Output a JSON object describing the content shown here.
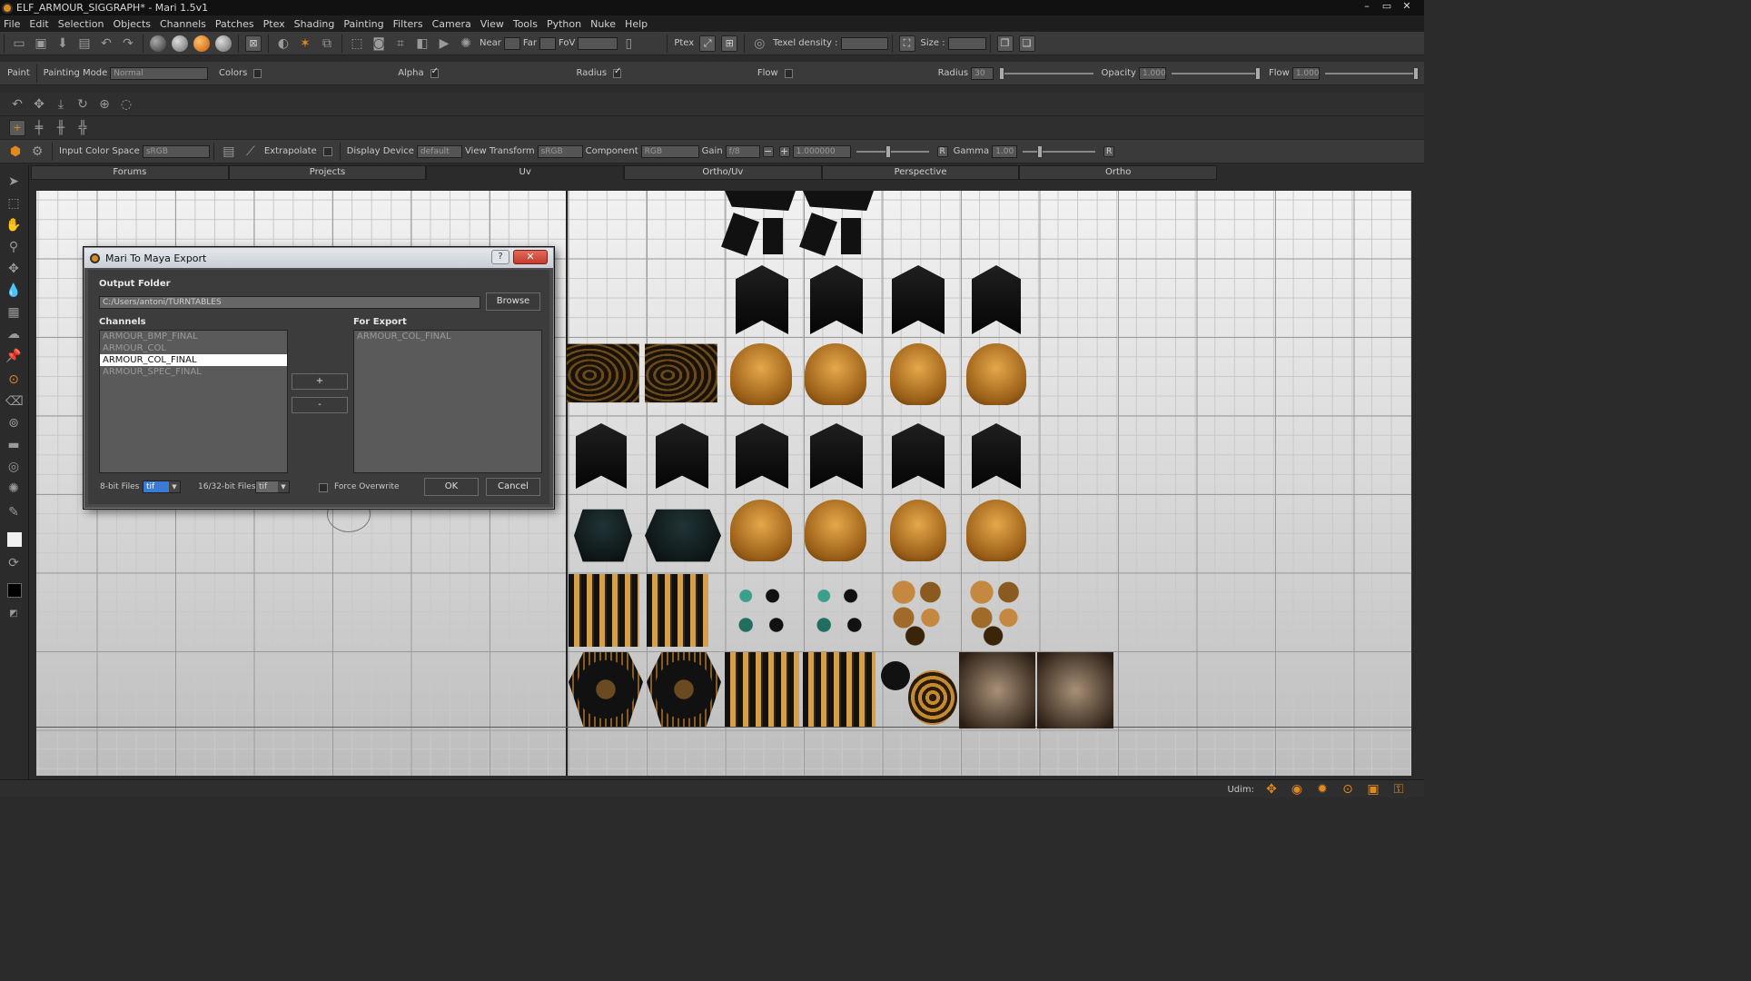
{
  "window": {
    "title": "ELF_ARMOUR_SIGGRAPH* - Mari 1.5v1",
    "controls": [
      "–",
      "▭",
      "✕"
    ]
  },
  "menu": [
    "File",
    "Edit",
    "Selection",
    "Objects",
    "Channels",
    "Patches",
    "Ptex",
    "Shading",
    "Painting",
    "Filters",
    "Camera",
    "View",
    "Tools",
    "Python",
    "Nuke",
    "Help"
  ],
  "toolbar1": {
    "near_label": "Near",
    "far_label": "Far",
    "fov_label": "FoV",
    "ptex_label": "Ptex",
    "texel_density_label": "Texel density :",
    "size_label": "Size :"
  },
  "paint_toolbar": {
    "paint_label": "Paint",
    "mode_label": "Painting Mode",
    "mode_value": "Normal",
    "colors_label": "Colors",
    "alpha_label": "Alpha",
    "radius_check_label": "Radius",
    "flow_check_label": "Flow",
    "radius_label": "Radius",
    "radius_value": "30",
    "opacity_label": "Opacity",
    "opacity_value": "1.000",
    "flow_label": "Flow",
    "flow_value": "1.000",
    "radius_slider": 0.05,
    "opacity_slider": 1.0,
    "flow_slider": 1.0
  },
  "color_toolbar": {
    "input_cs_label": "Input Color Space",
    "input_cs_value": "sRGB",
    "extrapolate_label": "Extrapolate",
    "display_device_label": "Display Device",
    "display_device_value": "default",
    "view_transform_label": "View Transform",
    "view_transform_value": "sRGB",
    "component_label": "Component",
    "component_value": "RGB",
    "gain_label": "Gain",
    "gain_value": "f/8",
    "gain_number": "1.000000",
    "r_label": "R",
    "gamma_label": "Gamma",
    "gamma_value": "1.00"
  },
  "tabs": [
    "Forums",
    "Projects",
    "Uv",
    "Ortho/Uv",
    "Perspective",
    "Ortho"
  ],
  "active_tab": "Uv",
  "dialog": {
    "title": "Mari To Maya Export",
    "help_label": "?",
    "close_label": "✕",
    "output_folder_label": "Output Folder",
    "output_folder_value": "C:/Users/antoni/TURNTABLES",
    "browse_label": "Browse",
    "channels_label": "Channels",
    "channels": [
      "ARMOUR_BMP_FINAL",
      "ARMOUR_COL",
      "ARMOUR_COL_FINAL",
      "ARMOUR_SPEC_FINAL"
    ],
    "selected_channel": "ARMOUR_COL_FINAL",
    "for_export_label": "For Export",
    "for_export": [
      "ARMOUR_COL_FINAL"
    ],
    "add_label": "+",
    "remove_label": "-",
    "bit8_label": "8-bit Files :",
    "bit8_value": "tif",
    "bit16_label": "16/32-bit Files :",
    "bit16_value": "tif",
    "force_overwrite_label": "Force Overwrite",
    "ok_label": "OK",
    "cancel_label": "Cancel"
  },
  "statusbar": {
    "udim_label": "Udim:"
  }
}
